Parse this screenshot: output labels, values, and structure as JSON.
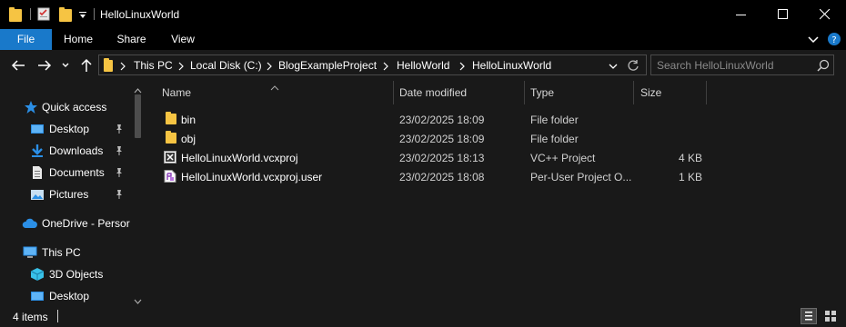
{
  "window": {
    "title": "HelloLinuxWorld",
    "controls": {
      "minimize": "minimize",
      "maximize": "maximize",
      "close": "close"
    }
  },
  "ribbon": {
    "tabs": [
      {
        "label": "File"
      },
      {
        "label": "Home"
      },
      {
        "label": "Share"
      },
      {
        "label": "View"
      }
    ]
  },
  "address": {
    "breadcrumb": [
      "This PC",
      "Local Disk (C:)",
      "BlogExampleProject",
      "HelloWorld",
      "HelloLinuxWorld"
    ]
  },
  "search": {
    "placeholder": "Search HelloLinuxWorld"
  },
  "nav": {
    "quick_access": "Quick access",
    "items": [
      {
        "label": "Desktop"
      },
      {
        "label": "Downloads"
      },
      {
        "label": "Documents"
      },
      {
        "label": "Pictures"
      }
    ],
    "onedrive": "OneDrive - Persor",
    "this_pc": "This PC",
    "pc_items": [
      {
        "label": "3D Objects"
      },
      {
        "label": "Desktop"
      }
    ]
  },
  "columns": {
    "name": "Name",
    "date": "Date modified",
    "type": "Type",
    "size": "Size"
  },
  "files": [
    {
      "name": "bin",
      "date": "23/02/2025 18:09",
      "type": "File folder",
      "size": "",
      "icon": "folder-icon"
    },
    {
      "name": "obj",
      "date": "23/02/2025 18:09",
      "type": "File folder",
      "size": "",
      "icon": "folder-icon"
    },
    {
      "name": "HelloLinuxWorld.vcxproj",
      "date": "23/02/2025 18:13",
      "type": "VC++ Project",
      "size": "4 KB",
      "icon": "vcxproj-file-icon"
    },
    {
      "name": "HelloLinuxWorld.vcxproj.user",
      "date": "23/02/2025 18:08",
      "type": "Per-User Project O...",
      "size": "1 KB",
      "icon": "vcxproj-user-file-icon"
    }
  ],
  "status": {
    "items": "4 items"
  },
  "colors": {
    "accent": "#1979ca",
    "folder": "#f6c443",
    "background": "#191919"
  }
}
